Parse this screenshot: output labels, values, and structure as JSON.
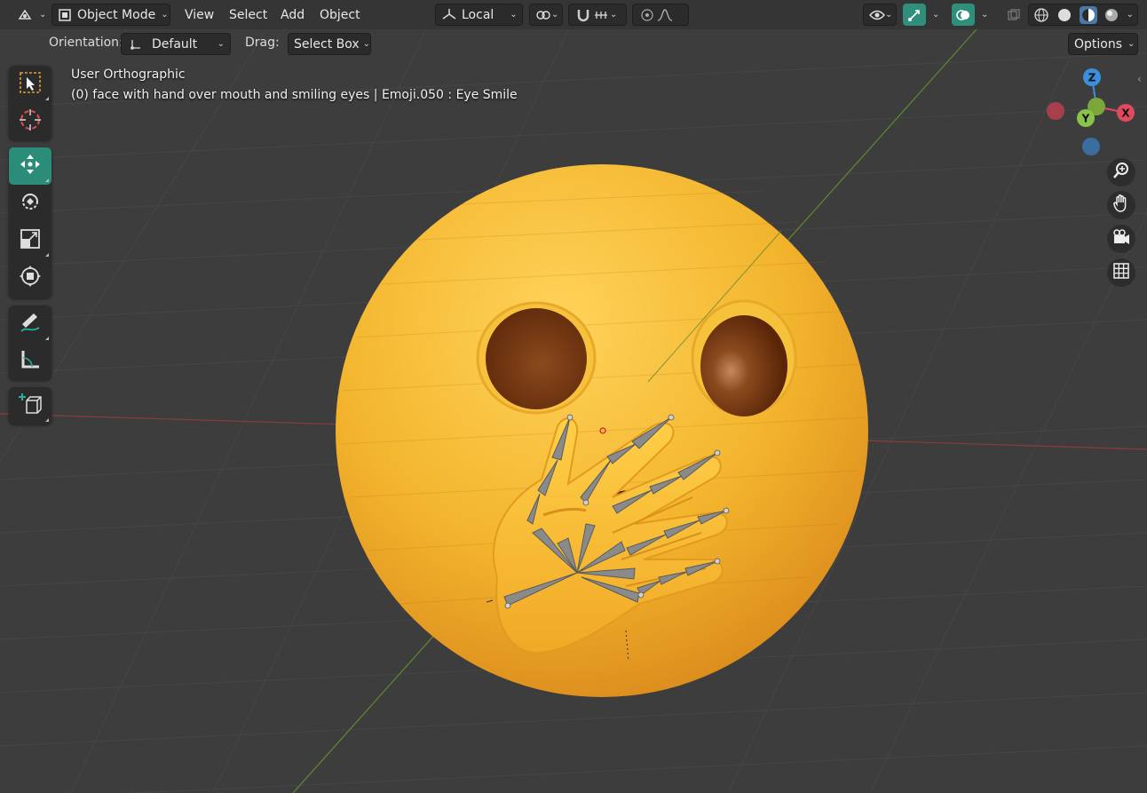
{
  "header": {
    "mode_label": "Object Mode",
    "menus": [
      "View",
      "Select",
      "Add",
      "Object"
    ],
    "transform_orientation": "Local",
    "options_label": "Options"
  },
  "toolsettings": {
    "orientation_label": "Orientation:",
    "orientation_value": "Default",
    "drag_label": "Drag:",
    "drag_value": "Select Box"
  },
  "viewport": {
    "view_name": "User Orthographic",
    "object_info": "(0) face with hand over mouth and smiling eyes | Emoji.050 : Eye Smile"
  },
  "gizmo": {
    "z_label": "Z",
    "y_label": "Y",
    "x_label": "X"
  },
  "colors": {
    "accent": "#2a8c79",
    "emoji_yellow": "#f2b62c",
    "emoji_shadow": "#d98a17",
    "eye_brown": "#7a3a12",
    "axis_x": "#e04a5d",
    "axis_y": "#8bc34a",
    "axis_z": "#3c8fdc"
  },
  "icons": {
    "tools": [
      "select-box-icon",
      "cursor-icon",
      "move-icon",
      "rotate-icon",
      "scale-icon",
      "transform-icon",
      "annotate-icon",
      "measure-icon",
      "add-cube-icon"
    ]
  }
}
